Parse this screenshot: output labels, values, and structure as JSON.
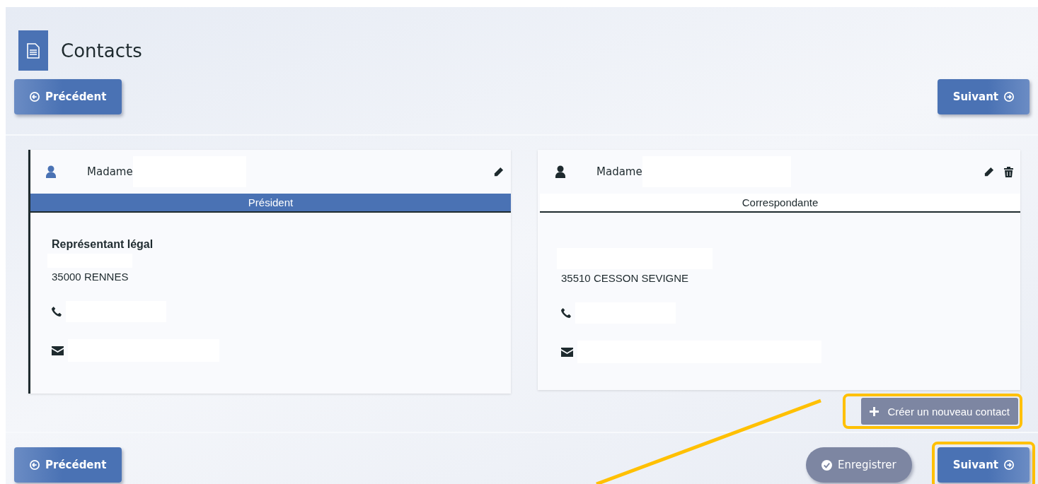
{
  "page": {
    "title": "Contacts"
  },
  "top_nav": [
    {
      "label": "Précédent",
      "kind": "prev",
      "highlighted": false
    },
    {
      "label": "Suivant",
      "kind": "next",
      "highlighted": false
    }
  ],
  "contacts": [
    {
      "civility": "Madame",
      "role": "Président",
      "selected": true,
      "heading": "Représentant légal",
      "city_line": "35000 RENNES",
      "can_delete": false
    },
    {
      "civility": "Madame",
      "role": "Correspondante",
      "selected": false,
      "city_line": "35510 CESSON SEVIGNE",
      "can_delete": true
    }
  ],
  "create_button": {
    "label": "Créer un nouveau contact",
    "highlighted": true
  },
  "bottom_nav": [
    {
      "label": "Précédent",
      "kind": "prev",
      "highlighted": false
    },
    {
      "label": "Enregistrer",
      "kind": "save",
      "highlighted": false
    },
    {
      "label": "Suivant",
      "kind": "next",
      "highlighted": true
    }
  ]
}
